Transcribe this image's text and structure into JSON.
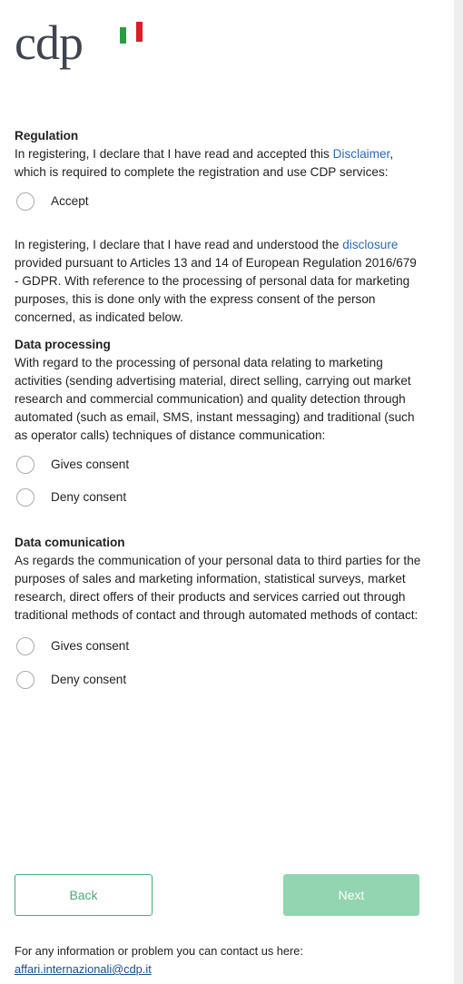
{
  "logo": {
    "text": "cdp"
  },
  "colors": {
    "accent": "#48ad79",
    "link": "#2a6bb5",
    "flag_green": "#2e9a44",
    "flag_red": "#d61f26"
  },
  "regulation": {
    "title": "Regulation",
    "text_before": "In registering, I declare that I have read and accepted this ",
    "link": "Disclaimer",
    "text_after": ", which is required to complete the registration and use CDP services:",
    "accept_label": "Accept",
    "accept_selected": false
  },
  "gdpr": {
    "text_before": "In registering, I declare that I have read and understood the ",
    "link": "disclosure",
    "text_after": " provided pursuant to Articles 13 and 14 of European Regulation 2016/679 - GDPR. With reference to the processing of personal data for marketing purposes, this is done only with the express consent of the person concerned, as indicated below."
  },
  "data_processing": {
    "title": "Data processing",
    "text": "With regard to the processing of personal data relating to marketing activities (sending advertising material, direct selling, carrying out market research and commercial communication) and quality detection through automated (such as email, SMS, instant messaging) and traditional (such as operator calls) techniques of distance communication:",
    "options": [
      "Gives consent",
      "Deny consent"
    ]
  },
  "data_communication": {
    "title": "Data comunication",
    "text": "As regards the communication of your personal data to third parties for the purposes of sales and marketing information, statistical surveys, market research, direct offers of their products and services carried out through traditional methods of contact and through automated methods of contact:",
    "options": [
      "Gives consent",
      "Deny consent"
    ]
  },
  "buttons": {
    "back": "Back",
    "next": "Next"
  },
  "footer": {
    "text": "For any information or problem you can contact us here:",
    "email": "affari.internazionali@cdp.it"
  }
}
